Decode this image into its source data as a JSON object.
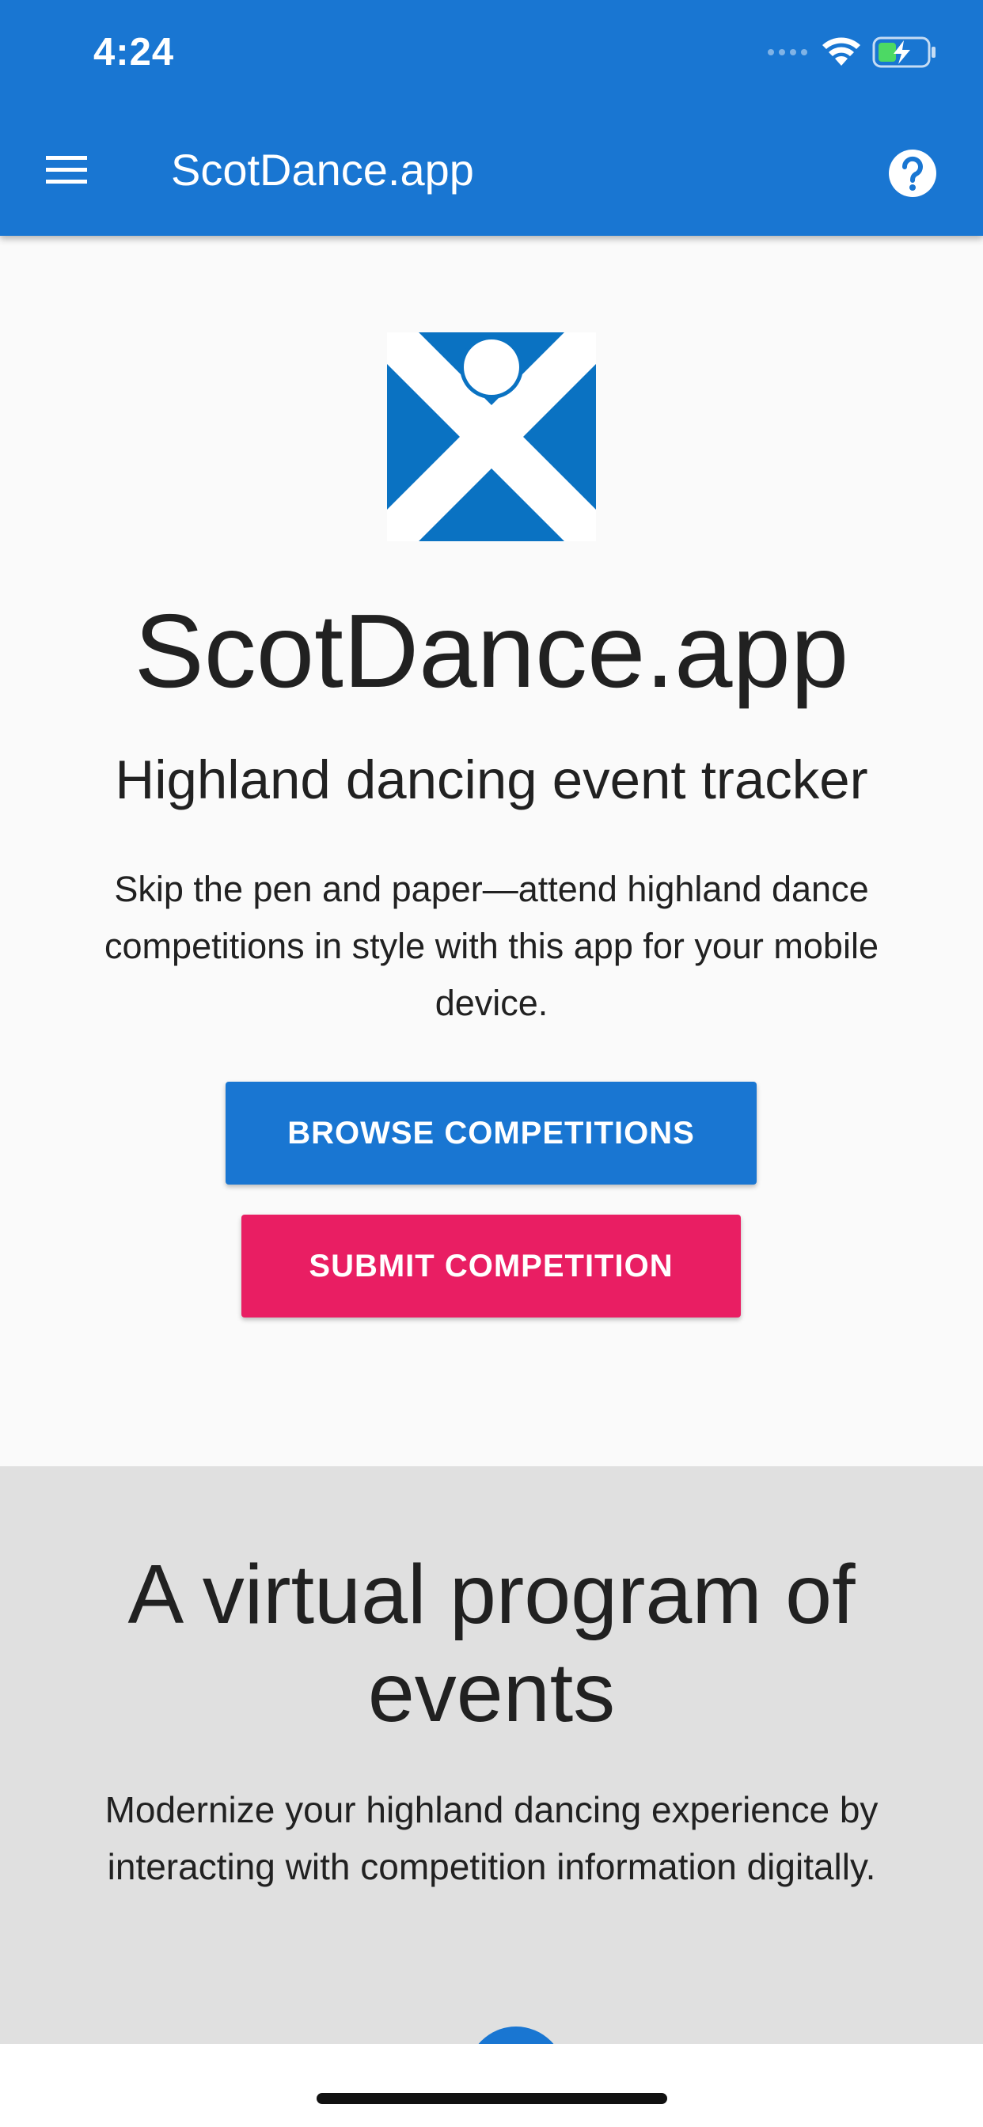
{
  "status_bar": {
    "time": "4:24"
  },
  "app_bar": {
    "title": "ScotDance.app",
    "menu_icon": "hamburger-menu-icon",
    "help_icon": "help-circle-icon"
  },
  "hero": {
    "logo": "saltire-dancer-logo",
    "title": "ScotDance.app",
    "subtitle": "Highland dancing event tracker",
    "description": "Skip the pen and paper—attend highland dance competitions in style with this app for your mobile device.",
    "browse_button": "BROWSE COMPETITIONS",
    "submit_button": "SUBMIT COMPETITION"
  },
  "feature": {
    "title": "A virtual program of events",
    "description": "Modernize your highland dancing experience by interacting with competition information digitally."
  },
  "colors": {
    "primary": "#1976d2",
    "accent": "#e91e63",
    "background": "#fafafa",
    "feature_background": "#e0e0e0"
  }
}
